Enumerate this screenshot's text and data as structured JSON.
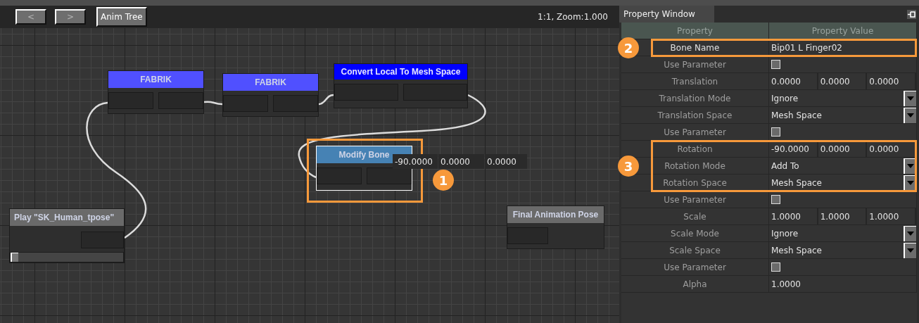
{
  "graph_toolbar": {
    "buttons": [
      {
        "label": "<",
        "disabled": true
      },
      {
        "label": ">",
        "disabled": true
      },
      {
        "label": "Anim Tree",
        "disabled": false
      }
    ],
    "zoom_label": "1:1, Zoom:1.000"
  },
  "graph": {
    "nodes": [
      {
        "title": "FABRIK",
        "kind": "blend",
        "color": "#5050ff",
        "selected": false
      },
      {
        "title": "FABRIK",
        "kind": "blend",
        "color": "#5050ff",
        "selected": false
      },
      {
        "title": "Convert Local To Mesh Space",
        "kind": "blend",
        "color": "#0000ff",
        "selected": false
      },
      {
        "title": "Modify Bone",
        "kind": "blend",
        "color": "#4682b4",
        "selected": true,
        "callout": "1",
        "overlay_values": [
          "-90.0000",
          "0.0000",
          "0.0000"
        ]
      },
      {
        "title": "Play \"SK_Human_tpose\"",
        "kind": "source",
        "color": "#6a6a6a",
        "selected": false,
        "level": 0
      },
      {
        "title": "Final Animation Pose",
        "kind": "result",
        "color": "#6a6a6a",
        "selected": false
      }
    ]
  },
  "property_window": {
    "title": "Property Window",
    "columns": [
      "Property",
      "Property Value"
    ],
    "rows": [
      {
        "name": "Bone Name",
        "kind": "text",
        "value": "Bip01 L Finger02",
        "highlighted": true,
        "callout": "2"
      },
      {
        "name": "Use Parameter",
        "kind": "checkbox",
        "checked": false
      },
      {
        "name": "Translation",
        "kind": "vector",
        "values": [
          "0.0000",
          "0.0000",
          "0.0000"
        ]
      },
      {
        "name": "Translation Mode",
        "kind": "dropdown",
        "value": "Ignore"
      },
      {
        "name": "Translation Space",
        "kind": "dropdown",
        "value": "Mesh Space"
      },
      {
        "name": "Use Parameter",
        "kind": "checkbox",
        "checked": false
      },
      {
        "name": "Rotation",
        "kind": "vector",
        "values": [
          "-90.0000",
          "0.0000",
          "0.0000"
        ],
        "highlighted": true,
        "callout": "3"
      },
      {
        "name": "Rotation Mode",
        "kind": "dropdown",
        "value": "Add To",
        "highlighted": true
      },
      {
        "name": "Rotation Space",
        "kind": "dropdown",
        "value": "Mesh Space",
        "highlighted": true
      },
      {
        "name": "Use Parameter",
        "kind": "checkbox",
        "checked": false
      },
      {
        "name": "Scale",
        "kind": "vector",
        "values": [
          "1.0000",
          "1.0000",
          "1.0000"
        ]
      },
      {
        "name": "Scale Mode",
        "kind": "dropdown",
        "value": "Ignore"
      },
      {
        "name": "Scale Space",
        "kind": "dropdown",
        "value": "Mesh Space"
      },
      {
        "name": "Use Parameter",
        "kind": "checkbox",
        "checked": false
      },
      {
        "name": "Alpha",
        "kind": "text",
        "value": "1.0000"
      }
    ]
  }
}
